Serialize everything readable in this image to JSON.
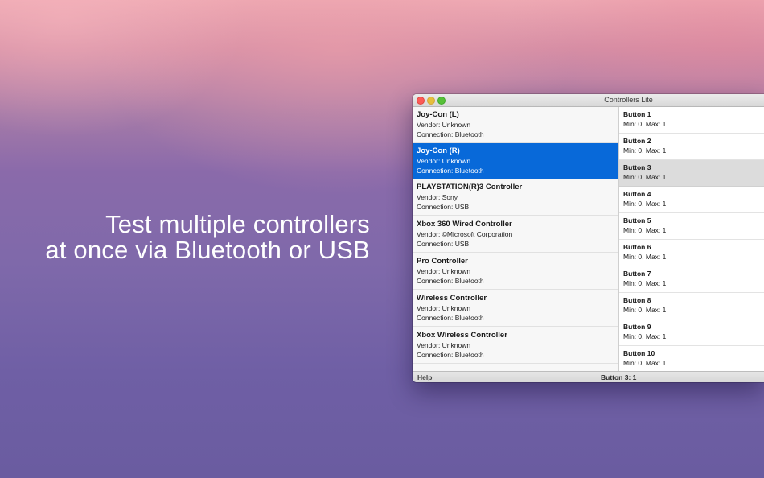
{
  "tagline": {
    "line1": "Test multiple controllers",
    "line2": "at once via Bluetooth or USB"
  },
  "window": {
    "title": "Controllers Lite"
  },
  "controllers": [
    {
      "name": "Joy-Con (L)",
      "vendor": "Vendor: Unknown",
      "connection": "Connection: Bluetooth",
      "selected": false
    },
    {
      "name": "Joy-Con (R)",
      "vendor": "Vendor: Unknown",
      "connection": "Connection: Bluetooth",
      "selected": true
    },
    {
      "name": "PLAYSTATION(R)3 Controller",
      "vendor": "Vendor: Sony",
      "connection": "Connection: USB",
      "selected": false
    },
    {
      "name": "Xbox 360 Wired Controller",
      "vendor": "Vendor: ©Microsoft Corporation",
      "connection": "Connection: USB",
      "selected": false
    },
    {
      "name": "Pro Controller",
      "vendor": "Vendor: Unknown",
      "connection": "Connection: Bluetooth",
      "selected": false
    },
    {
      "name": "Wireless Controller",
      "vendor": "Vendor: Unknown",
      "connection": "Connection: Bluetooth",
      "selected": false
    },
    {
      "name": "Xbox Wireless Controller",
      "vendor": "Vendor: Unknown",
      "connection": "Connection: Bluetooth",
      "selected": false
    }
  ],
  "buttons": [
    {
      "name": "Button 1",
      "range": "Min: 0, Max: 1",
      "active": false
    },
    {
      "name": "Button 2",
      "range": "Min: 0, Max: 1",
      "active": false
    },
    {
      "name": "Button 3",
      "range": "Min: 0, Max: 1",
      "active": true
    },
    {
      "name": "Button 4",
      "range": "Min: 0, Max: 1",
      "active": false
    },
    {
      "name": "Button 5",
      "range": "Min: 0, Max: 1",
      "active": false
    },
    {
      "name": "Button 6",
      "range": "Min: 0, Max: 1",
      "active": false
    },
    {
      "name": "Button 7",
      "range": "Min: 0, Max: 1",
      "active": false
    },
    {
      "name": "Button 8",
      "range": "Min: 0, Max: 1",
      "active": false
    },
    {
      "name": "Button 9",
      "range": "Min: 0, Max: 1",
      "active": false
    },
    {
      "name": "Button 10",
      "range": "Min: 0, Max: 1",
      "active": false
    }
  ],
  "statusbar": {
    "help_label": "Help",
    "status": "Button 3: 1"
  },
  "colors": {
    "selection": "#0869d9",
    "active_row": "#dcdcdc",
    "close": "#fc5b57",
    "minimize": "#e5bf3c",
    "maximize": "#57c038"
  }
}
